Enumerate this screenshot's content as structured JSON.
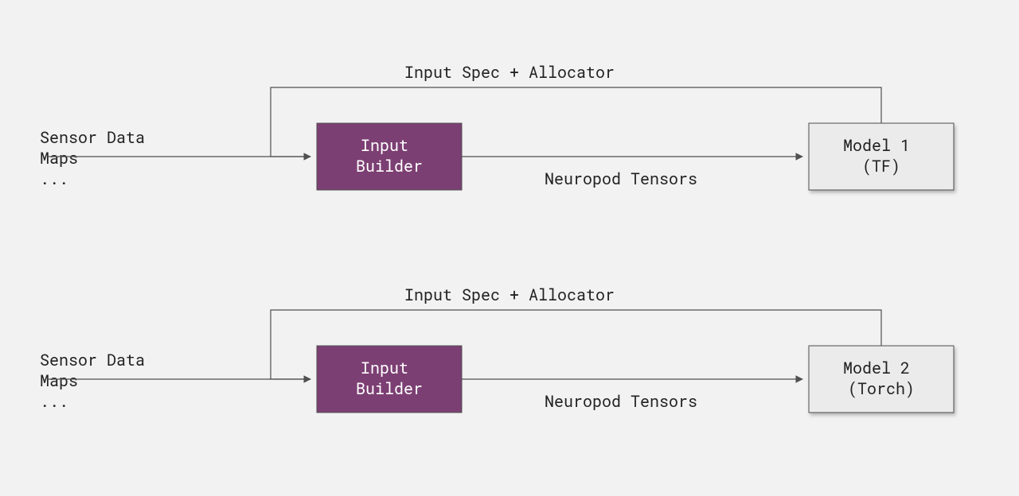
{
  "diagram": {
    "pipelines": [
      {
        "source_lines": [
          "Sensor Data",
          "Maps",
          "..."
        ],
        "builder_lines": [
          "Input",
          "Builder"
        ],
        "model_lines": [
          "Model 1",
          "(TF)"
        ],
        "feedback_label": "Input Spec + Allocator",
        "forward_label": "Neuropod Tensors"
      },
      {
        "source_lines": [
          "Sensor Data",
          "Maps",
          "..."
        ],
        "builder_lines": [
          "Input",
          "Builder"
        ],
        "model_lines": [
          "Model 2",
          "(Torch)"
        ],
        "feedback_label": "Input Spec + Allocator",
        "forward_label": "Neuropod Tensors"
      }
    ]
  }
}
